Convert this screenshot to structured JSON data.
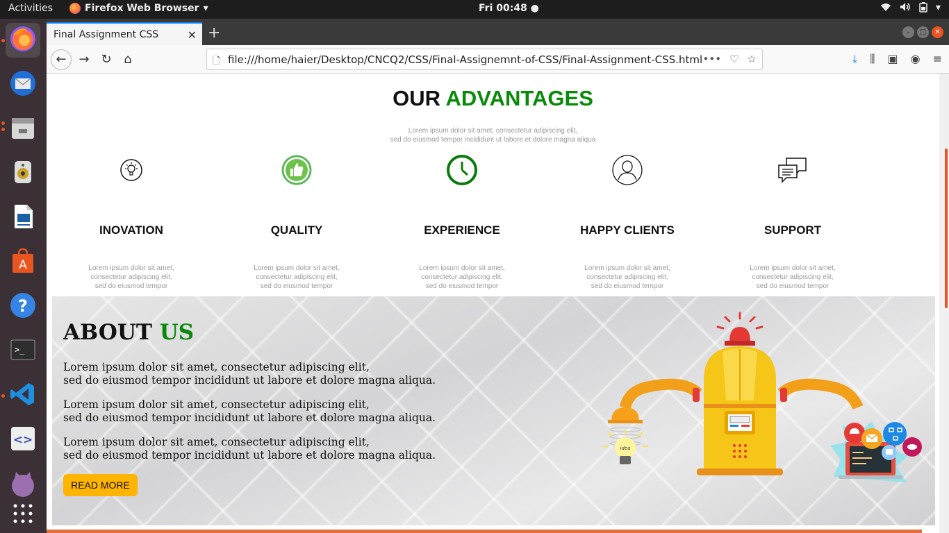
{
  "system": {
    "activities": "Activities",
    "app_name": "Firefox Web Browser",
    "clock": "Fri 00:48 ●"
  },
  "browser": {
    "tab_title": "Final Assignment CSS",
    "url": "file:///home/haier/Desktop/CNCQ2/CSS/Final-Assignemnt-of-CSS/Final-Assignment-CSS.html"
  },
  "advantages": {
    "title_part1": "OUR",
    "title_part2": "ADVANTAGES",
    "subtitle_line1": "Lorem ipsum dolor sit amet, consectetur adipiscing elit,",
    "subtitle_line2": "sed do eiusmod tempor incididunt ut labore et dolore magna aliqua",
    "items": [
      {
        "name": "INOVATION",
        "icon": "lightbulb-icon",
        "desc1": "Lorem ipsum dolor sit amet,",
        "desc2": "consectetur adipiscing elit,",
        "desc3": "sed do eiusmod tempor"
      },
      {
        "name": "QUALITY",
        "icon": "thumbs-up-icon",
        "desc1": "Lorem ipsum dolor sit amet,",
        "desc2": "consectetur adipiscing elit,",
        "desc3": "sed do eiusmod tempor"
      },
      {
        "name": "EXPERIENCE",
        "icon": "clock-icon",
        "desc1": "Lorem ipsum dolor sit amet,",
        "desc2": "consectetur adipiscing elit,",
        "desc3": "sed do eiusmod tempor"
      },
      {
        "name": "HAPPY CLIENTS",
        "icon": "user-icon",
        "desc1": "Lorem ipsum dolor sit amet,",
        "desc2": "consectetur adipiscing elit,",
        "desc3": "sed do eiusmod tempor"
      },
      {
        "name": "SUPPORT",
        "icon": "chat-icon",
        "desc1": "Lorem ipsum dolor sit amet,",
        "desc2": "consectetur adipiscing elit,",
        "desc3": "sed do eiusmod tempor"
      }
    ]
  },
  "about": {
    "title_part1": "ABOUT",
    "title_part2": "US",
    "paragraphs": [
      {
        "line1": "Lorem ipsum dolor sit amet, consectetur adipiscing elit,",
        "line2": "sed do eiusmod tempor incididunt ut labore et dolore magna aliqua."
      },
      {
        "line1": "Lorem ipsum dolor sit amet, consectetur adipiscing elit,",
        "line2": "sed do eiusmod tempor incididunt ut labore et dolore magna aliqua."
      },
      {
        "line1": "Lorem ipsum dolor sit amet, consectetur adipiscing elit,",
        "line2": "sed do eiusmod tempor incididunt ut labore et dolore magna aliqua."
      }
    ],
    "button": "READ MORE",
    "illustration_idea_label": "idea"
  },
  "colors": {
    "accent_green": "#0a8a0a",
    "button_yellow": "#ffb400",
    "ubuntu_orange": "#e95420"
  }
}
